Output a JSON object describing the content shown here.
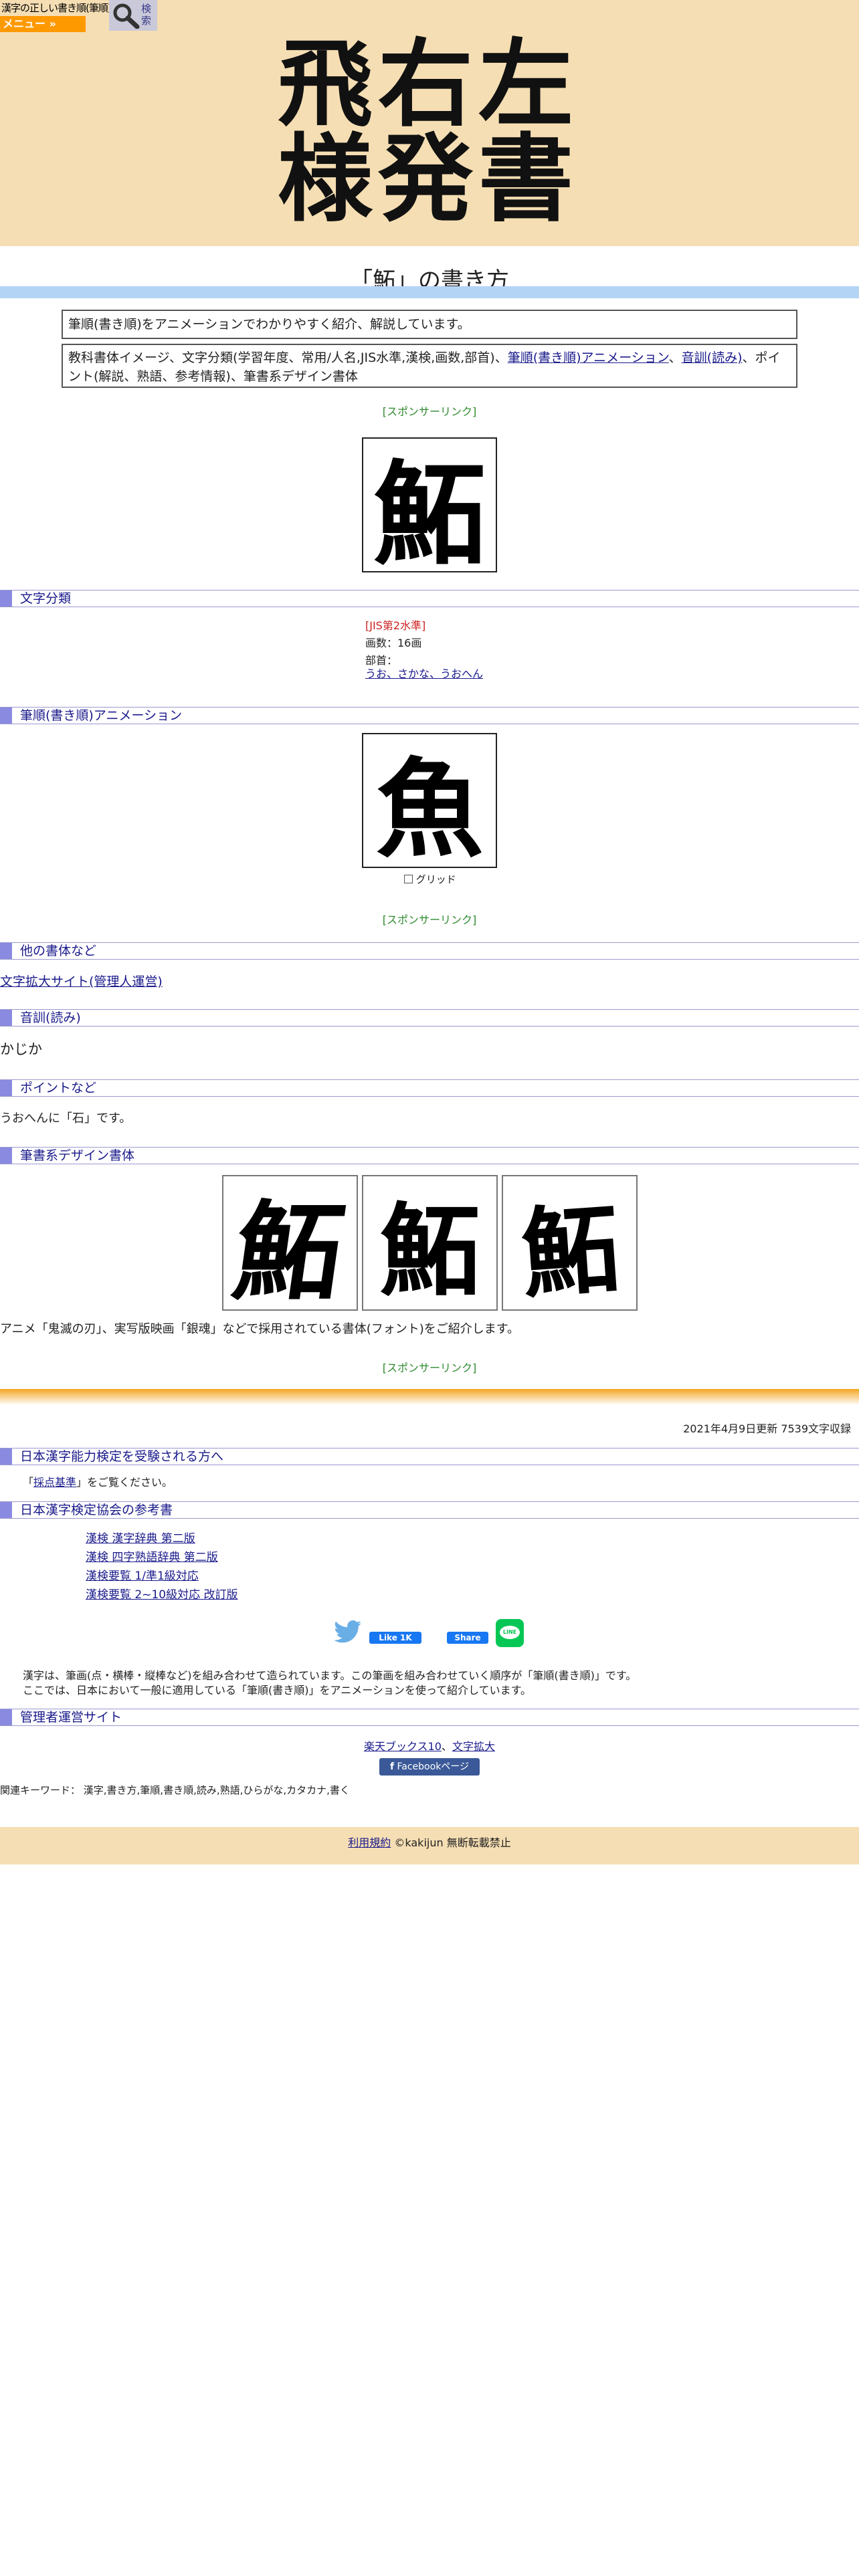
{
  "header": {
    "site_small_title": "漢字の正しい書き順(筆順)",
    "menu_label": "メニュー »",
    "search_label": "検索",
    "big_title_line1": "飛右左",
    "big_title_line2": "様発書"
  },
  "page_title": "「鮖」の書き方",
  "intro_box": "筆順(書き順)をアニメーションでわかりやすく紹介、解説しています。",
  "contents_box": {
    "prefix": "教科書体イメージ、文字分類(学習年度、常用/人名,JIS水準,漢検,画数,部首)、",
    "link1": "筆順(書き順)アニメーション",
    "sep": "、",
    "link2": "音訓(読み)",
    "suffix": "、ポイント(解説、熟語、参考情報)、筆書系デザイン書体"
  },
  "sponsor_label": "[スポンサーリンク]",
  "main_kanji": "鮖",
  "anim_kanji": "魚",
  "sections": {
    "classification": "文字分類",
    "stroke_anim": "筆順(書き順)アニメーション",
    "other_fonts": "他の書体など",
    "reading": "音訓(読み)",
    "points": "ポイントなど",
    "design_fonts": "筆書系デザイン書体",
    "kentei_takers": "日本漢字能力検定を受験される方へ",
    "kentei_refs": "日本漢字検定協会の参考書",
    "admin_sites": "管理者運営サイト"
  },
  "classification": {
    "jis": "[JIS第2水準]",
    "strokes": "画数：16画",
    "radical_label": "部首：",
    "radical_link": "うお、さかな、うおへん"
  },
  "grid_label": "グリッド",
  "other_fonts_link": "文字拡大サイト(管理人運営)",
  "reading": "かじか",
  "point_text": "うおへんに「石」です。",
  "design_fonts_desc": "アニメ「鬼滅の刃」、実写版映画「銀魂」などで採用されている書体(フォント)をご紹介します。",
  "update_info": "2021年4月9日更新 7539文字収録",
  "kentei_text": {
    "pre": "「",
    "link": "採点基準",
    "post": "」をご覧ください。"
  },
  "ref_books": [
    "漢検 漢字辞典 第二版",
    "漢検 四字熟語辞典 第二版",
    "漢検要覧 1/準1級対応",
    "漢検要覧 2~10級対応 改訂版"
  ],
  "social": {
    "like": "Like 1K",
    "share": "Share",
    "line": "LINE"
  },
  "about": {
    "line1": "漢字は、筆画(点・横棒・縦棒など)を組み合わせて造られています。この筆画を組み合わせていく順序が「筆順(書き順)」です。",
    "line2": "ここでは、日本において一般に適用している「筆順(書き順)」をアニメーションを使って紹介しています。"
  },
  "admin_links": {
    "link1": "楽天ブックス10",
    "sep": "、",
    "link2": "文字拡大",
    "facebook": "Facebookページ"
  },
  "keywords": "関連キーワード： 漢字,書き方,筆順,書き順,読み,熟語,ひらがな,カタカナ,書く",
  "footer": {
    "terms": "利用規約",
    "copyright": "©kakijun 無断転載禁止"
  },
  "colors": {
    "header_bg": "#f5deb3",
    "menu_orange": "#ff9900",
    "section_accent": "#8a8ae0",
    "sponsor_green": "#2e8b2e",
    "jis_red": "#cc2222"
  }
}
